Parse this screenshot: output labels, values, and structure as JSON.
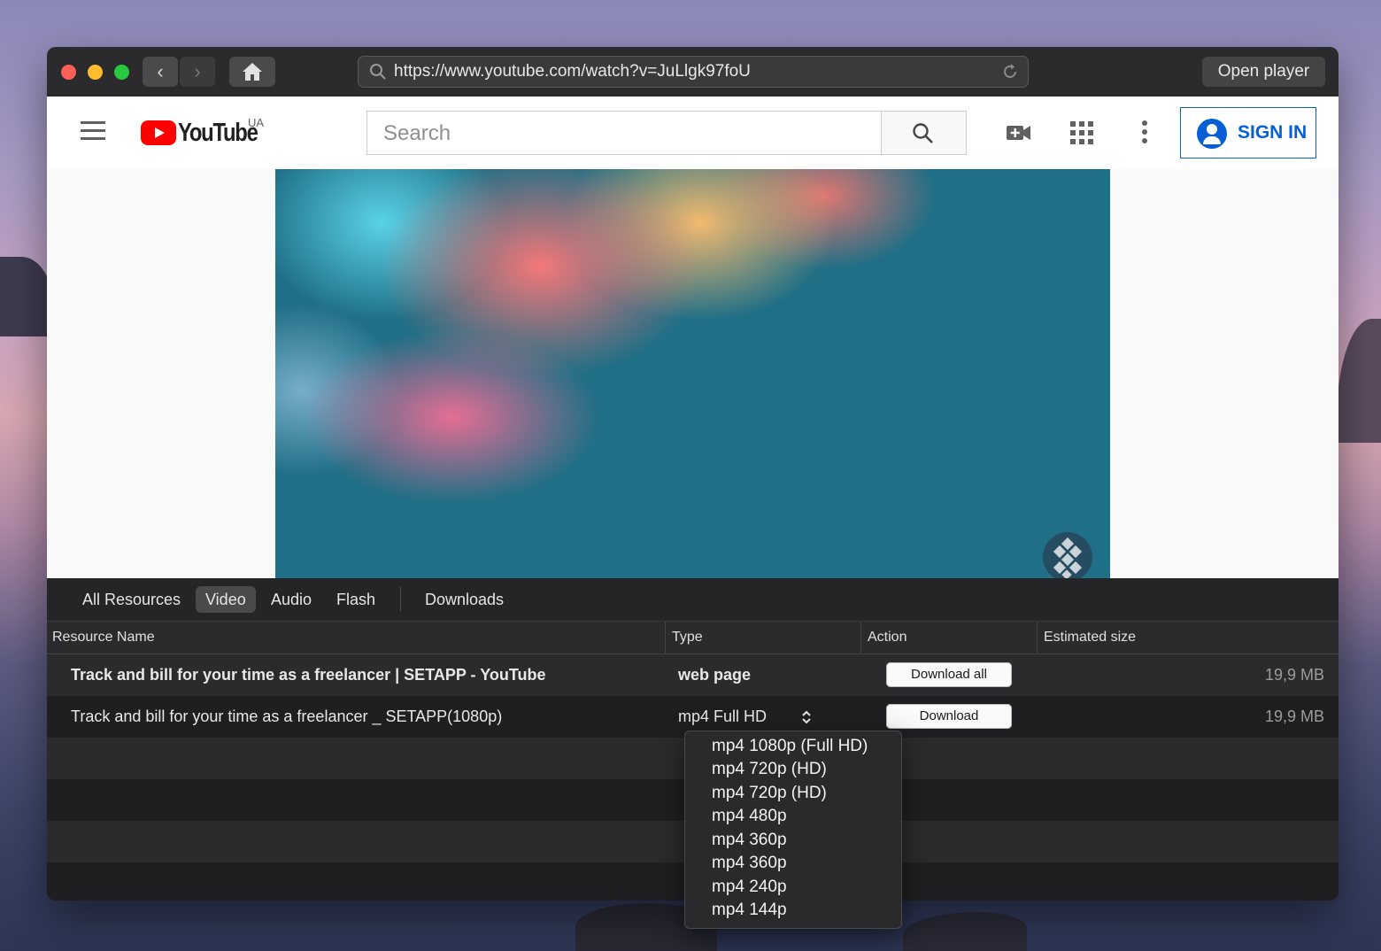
{
  "browser": {
    "url": "https://www.youtube.com/watch?v=JuLlgk97foU",
    "open_player_label": "Open player"
  },
  "youtube": {
    "logo_text": "YouTube",
    "region": "UA",
    "search_placeholder": "Search",
    "sign_in_label": "SIGN IN"
  },
  "panel": {
    "tabs": [
      {
        "label": "All Resources",
        "active": false
      },
      {
        "label": "Video",
        "active": true
      },
      {
        "label": "Audio",
        "active": false
      },
      {
        "label": "Flash",
        "active": false
      },
      {
        "label": "Downloads",
        "active": false
      }
    ],
    "columns": [
      "Resource Name",
      "Type",
      "Action",
      "Estimated size"
    ],
    "rows": [
      {
        "name": "Track and bill for your time as a freelancer | SETAPP - YouTube",
        "type": "web page",
        "action": "Download all",
        "size": "19,9 MB"
      },
      {
        "name": "Track and bill for your time as a freelancer _ SETAPP(1080p)",
        "type": "mp4 Full HD",
        "action": "Download",
        "size": "19,9 MB"
      }
    ]
  },
  "format_dropdown": {
    "options": [
      "mp4 1080p (Full HD)",
      "mp4 720p (HD)",
      "mp4 720p (HD)",
      "mp4 480p",
      "mp4 360p",
      "mp4 360p",
      "mp4 240p",
      "mp4 144p"
    ]
  },
  "colors": {
    "accent_blue": "#065fd4",
    "youtube_red": "#ff0000",
    "panel_bg": "#1f1f21"
  }
}
